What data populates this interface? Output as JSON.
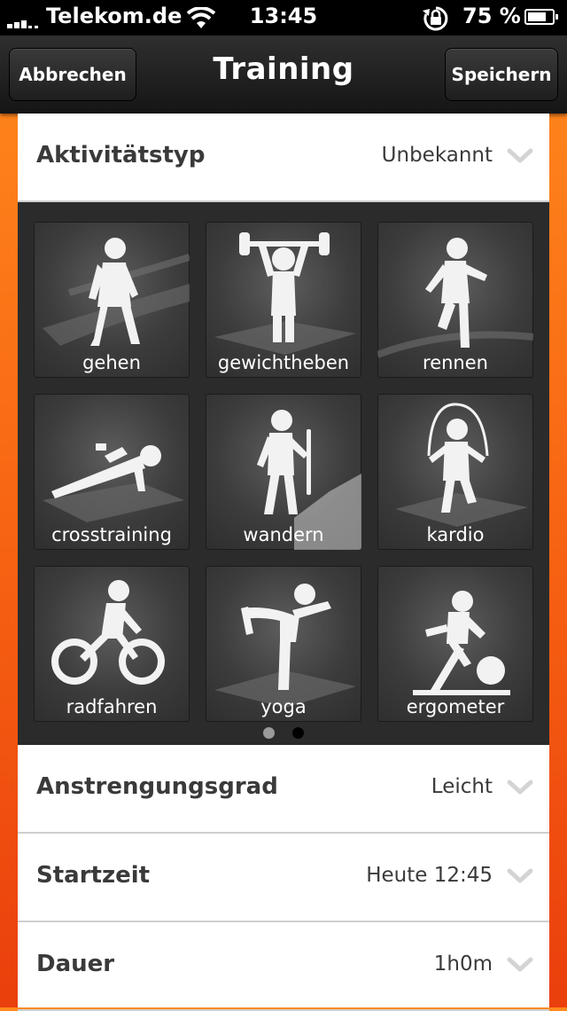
{
  "status_bar": {
    "carrier": "Telekom.de",
    "time": "13:45",
    "battery_percent": "75 %",
    "battery_level": 0.75,
    "icons": [
      "signal-icon",
      "wifi-icon",
      "rotation-lock-icon",
      "battery-icon"
    ]
  },
  "nav": {
    "title": "Training",
    "cancel_label": "Abbrechen",
    "save_label": "Speichern"
  },
  "rows": {
    "activity_type": {
      "label": "Aktivitätstyp",
      "value": "Unbekannt"
    },
    "effort": {
      "label": "Anstrengungsgrad",
      "value": "Leicht"
    },
    "start_time": {
      "label": "Startzeit",
      "value": "Heute 12:45"
    },
    "duration": {
      "label": "Dauer",
      "value": "1h0m"
    }
  },
  "activities": [
    {
      "label": "gehen",
      "icon": "walking-figure-icon"
    },
    {
      "label": "gewichtheben",
      "icon": "weightlifting-figure-icon"
    },
    {
      "label": "rennen",
      "icon": "running-figure-icon"
    },
    {
      "label": "crosstraining",
      "icon": "pushup-figure-icon"
    },
    {
      "label": "wandern",
      "icon": "hiking-figure-icon"
    },
    {
      "label": "kardio",
      "icon": "jumprope-figure-icon"
    },
    {
      "label": "radfahren",
      "icon": "cycling-figure-icon"
    },
    {
      "label": "yoga",
      "icon": "yoga-figure-icon"
    },
    {
      "label": "ergometer",
      "icon": "stationary-bike-figure-icon"
    }
  ],
  "pager": {
    "pages": 2,
    "current": 2
  },
  "colors": {
    "accent_top": "#ff8a1e",
    "accent_bottom": "#ea3f0c",
    "grid_bg": "#2b2b2b"
  }
}
